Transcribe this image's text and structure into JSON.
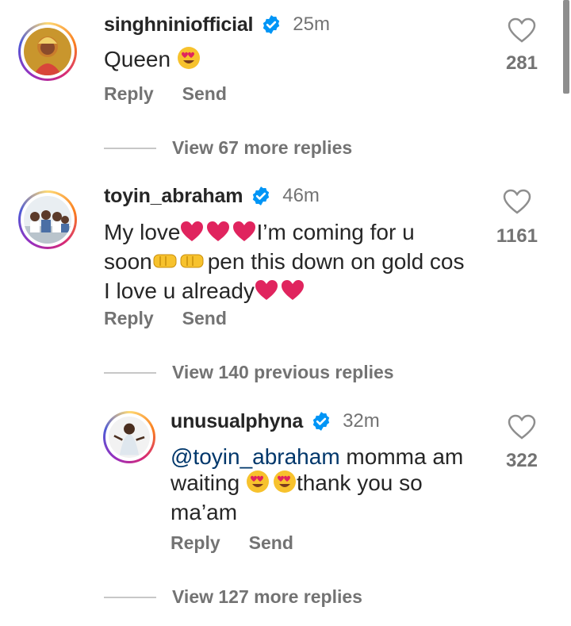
{
  "comments": [
    {
      "username": "singhniniofficial",
      "time": "25m",
      "text": "Queen",
      "likes": "281",
      "reply_label": "Reply",
      "send_label": "Send",
      "view_more": "View 67 more replies"
    },
    {
      "username": "toyin_abraham",
      "time": "46m",
      "line1_a": "My love",
      "line1_b": "I’m coming for u",
      "line2_a": "soon",
      "line2_b": "pen this down on gold cos",
      "line3_a": "I love u already",
      "likes": "1161",
      "reply_label": "Reply",
      "send_label": "Send",
      "view_more": "View 140 previous replies"
    },
    {
      "username": "unusualphyna",
      "time": "32m",
      "mention": "@toyin_abraham",
      "line1_b": " momma am",
      "line2_a": "waiting ",
      "line2_b": "thank you so",
      "line3_a": "ma’am",
      "likes": "322",
      "reply_label": "Reply",
      "send_label": "Send",
      "view_more": "View 127 more replies"
    }
  ],
  "colors": {
    "verified": "#0095f6",
    "secondary": "#737373",
    "mention": "#00376b",
    "heart_emoji": "#e0245e"
  }
}
